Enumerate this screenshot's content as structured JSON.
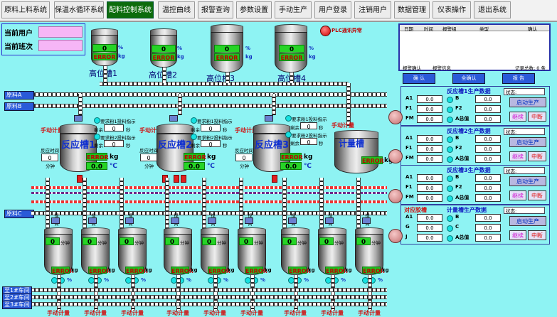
{
  "menu": [
    "原料上料系统",
    "保温水循环系统",
    "配料控制系统",
    "温控曲线",
    "报警查询",
    "参数设置",
    "手动生产",
    "用户登录",
    "注销用户",
    "数据管理",
    "仪表操作",
    "退出系统"
  ],
  "menu_active": 2,
  "user": {
    "current_user_label": "当前用户",
    "current_shift_label": "当前班次"
  },
  "plc_status": "PLC通讯异常",
  "high_tanks": [
    {
      "name": "高位槽1",
      "value": "0",
      "error": "ERROR",
      "u1": "%",
      "u2": "kg"
    },
    {
      "name": "高位槽2",
      "value": "0",
      "error": "ERROR",
      "u1": "%",
      "u2": "kg"
    },
    {
      "name": "高位槽3",
      "value": "0",
      "error": "ERROR",
      "u1": "%",
      "u2": "kg"
    },
    {
      "name": "高位槽4",
      "value": "0",
      "error": "ERROR",
      "u1": "%",
      "u2": "kg"
    }
  ],
  "sources": {
    "a": "原料A",
    "b": "原料B",
    "c": "原料C"
  },
  "reactors": [
    {
      "name": "反应槽1",
      "manual": "手动计量",
      "time_label": "反应时间",
      "minutes": "0",
      "min_unit": "分钟",
      "error": "ERROR",
      "kg": "kg",
      "temp": "0.0",
      "temp_unit": "℃",
      "req1": "要求粉1投料指示",
      "req2": "要求粉2投料指示",
      "remain": "剩余",
      "remain1": "0",
      "remain2": "0",
      "sec": "秒"
    },
    {
      "name": "反应槽2",
      "manual": "手动计量",
      "time_label": "反应时间",
      "minutes": "0",
      "min_unit": "分钟",
      "error": "ERROR",
      "kg": "kg",
      "temp": "0.0",
      "temp_unit": "℃",
      "req1": "要求粉1投料指示",
      "req2": "要求粉2投料指示",
      "remain": "剩余",
      "remain1": "0",
      "remain2": "0",
      "sec": "秒"
    },
    {
      "name": "反应槽3",
      "manual": "手动计量",
      "time_label": "反应时间",
      "minutes": "0",
      "min_unit": "分钟",
      "error": "ERROR",
      "kg": "kg",
      "temp": "0.0",
      "temp_unit": "℃",
      "req1": "要求粉1投料指示",
      "req2": "要求粉2投料指示",
      "remain": "剩余",
      "remain1": "0",
      "remain2": "0",
      "sec": "秒"
    }
  ],
  "meter_tank": {
    "name": "计量槽",
    "manual": "手动计量",
    "error": "ERROR",
    "kg": "kg"
  },
  "small_tanks": [
    {
      "value": "0",
      "min": "分钟",
      "error": "ERROR",
      "kg": "kg",
      "pct": "%",
      "manual": "手动计量",
      "stir": "搅拌间"
    },
    {
      "value": "0",
      "min": "分钟",
      "error": "ERROR",
      "kg": "kg",
      "pct": "%",
      "manual": "手动计量",
      "stir": "搅拌间"
    },
    {
      "value": "0",
      "min": "分钟",
      "error": "ERROR",
      "kg": "kg",
      "pct": "%",
      "manual": "手动计量",
      "stir": "搅拌间"
    },
    {
      "value": "0",
      "min": "分钟",
      "error": "ERROR",
      "kg": "kg",
      "pct": "%",
      "manual": "手动计量",
      "stir": "搅拌间"
    },
    {
      "value": "0",
      "min": "分钟",
      "error": "ERROR",
      "kg": "kg",
      "pct": "%",
      "manual": "手动计量",
      "stir": "搅拌间"
    },
    {
      "value": "0",
      "min": "分钟",
      "error": "ERROR",
      "kg": "kg",
      "pct": "%",
      "manual": "手动计量",
      "stir": "搅拌间"
    },
    {
      "value": "0",
      "min": "分钟",
      "error": "ERROR",
      "kg": "kg",
      "pct": "%",
      "manual": "手动计量",
      "stir": "搅拌间"
    },
    {
      "value": "0",
      "min": "分钟",
      "error": "ERROR",
      "kg": "kg",
      "pct": "%",
      "manual": "手动计量",
      "stir": "搅拌间"
    },
    {
      "value": "0",
      "min": "分钟",
      "error": "ERROR",
      "kg": "kg",
      "pct": "%",
      "manual": "手动计量",
      "stir": "搅拌间"
    }
  ],
  "workshops": [
    "至1#车间",
    "至2#车间",
    "至3#车间"
  ],
  "alarm": {
    "columns": [
      "日期",
      "时间",
      "报警组",
      "类型",
      "确认"
    ],
    "footer_left": "报警确认",
    "footer_mid": "报警信息",
    "footer_right": "记录总数: 0 条",
    "buttons": [
      "确 认",
      "全确认",
      "报 告"
    ]
  },
  "panels": [
    {
      "title": "反应槽1生产数据",
      "status": "状态:",
      "rows": [
        {
          "l": "A1",
          "v1": "0.0",
          "r": "B",
          "v2": "0.0"
        },
        {
          "l": "F1",
          "v1": "0.0",
          "r": "F2",
          "v2": "0.0"
        },
        {
          "l": "FM",
          "v1": "0.0",
          "r": "A总值",
          "v2": "0.0"
        }
      ],
      "start": "启动生产",
      "cont": "继续",
      "stop": "中断"
    },
    {
      "title": "反应槽2生产数据",
      "status": "状态:",
      "rows": [
        {
          "l": "A1",
          "v1": "0.0",
          "r": "B",
          "v2": "0.0"
        },
        {
          "l": "F1",
          "v1": "0.0",
          "r": "F2",
          "v2": "0.0"
        },
        {
          "l": "FM",
          "v1": "0.0",
          "r": "A总值",
          "v2": "0.0"
        }
      ],
      "start": "启动生产",
      "cont": "继续",
      "stop": "中断"
    },
    {
      "title": "反应槽3生产数据",
      "status": "状态:",
      "rows": [
        {
          "l": "A1",
          "v1": "0.0",
          "r": "B",
          "v2": "0.0"
        },
        {
          "l": "F1",
          "v1": "0.0",
          "r": "F2",
          "v2": "0.0"
        },
        {
          "l": "FM",
          "v1": "0.0",
          "r": "A总值",
          "v2": "0.0"
        }
      ],
      "start": "启动生产",
      "cont": "继续",
      "stop": "中断"
    },
    {
      "title": "计量槽生产数据",
      "prefix": "对应胶槽",
      "status": "状态:",
      "rows": [
        {
          "l": "A1",
          "v1": "0.0",
          "r": "B",
          "v2": "0.0"
        },
        {
          "l": "G",
          "v1": "0.0",
          "r": "C",
          "v2": "0.0"
        },
        {
          "l": "J",
          "v1": "0.0",
          "r": "A总值",
          "v2": "0.0"
        }
      ],
      "start": "启动生产",
      "cont": "继续",
      "stop": "中断"
    }
  ]
}
